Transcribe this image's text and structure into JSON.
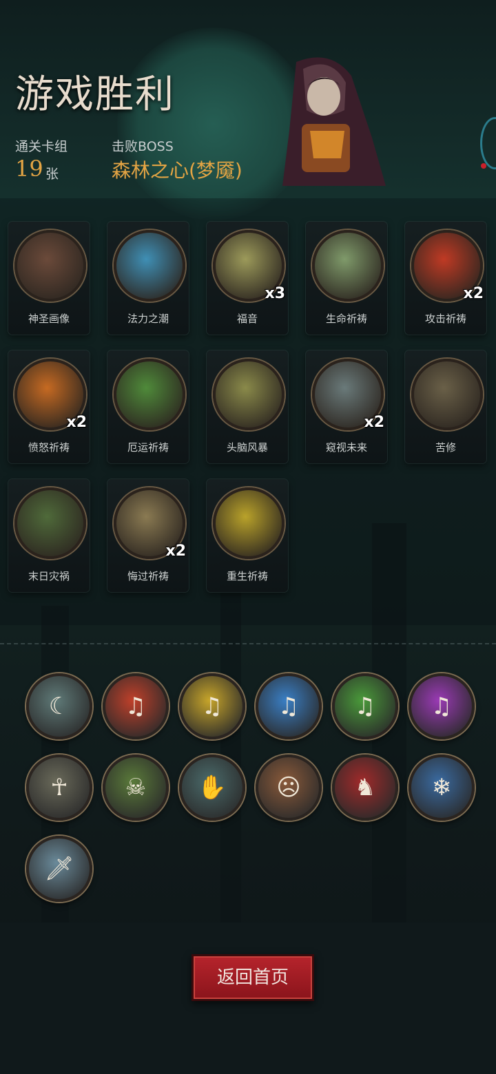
{
  "header": {
    "title": "游戏胜利",
    "deck_label": "通关卡组",
    "deck_count": "19",
    "deck_unit": "张",
    "boss_label": "击败BOSS",
    "boss_name": "森林之心(梦魇)"
  },
  "cards": [
    {
      "name": "神圣画像",
      "count": "",
      "icon": "holy-portrait-icon",
      "color": "#6b4a3a"
    },
    {
      "name": "法力之潮",
      "count": "",
      "icon": "mana-tide-icon",
      "color": "#3f8fb5"
    },
    {
      "name": "福音",
      "count": "x3",
      "icon": "gospel-hammer-icon",
      "color": "#9c9a5a"
    },
    {
      "name": "生命祈祷",
      "count": "",
      "icon": "life-prayer-icon",
      "color": "#7f9a6a"
    },
    {
      "name": "攻击祈祷",
      "count": "x2",
      "icon": "attack-prayer-icon",
      "color": "#c03a24"
    },
    {
      "name": "愤怒祈祷",
      "count": "x2",
      "icon": "wrath-prayer-icon",
      "color": "#c66a22"
    },
    {
      "name": "厄运祈祷",
      "count": "",
      "icon": "doom-prayer-icon",
      "color": "#4f8a3a"
    },
    {
      "name": "头脑风暴",
      "count": "",
      "icon": "brainstorm-icon",
      "color": "#8a8a4a"
    },
    {
      "name": "窥视未来",
      "count": "x2",
      "icon": "foresight-icon",
      "color": "#6a7a7a"
    },
    {
      "name": "苦修",
      "count": "",
      "icon": "penance-icon",
      "color": "#6a6048"
    },
    {
      "name": "末日灾祸",
      "count": "",
      "icon": "doomsday-icon",
      "color": "#4f6a3a"
    },
    {
      "name": "悔过祈祷",
      "count": "x2",
      "icon": "repentance-icon",
      "color": "#8a7a52"
    },
    {
      "name": "重生祈祷",
      "count": "",
      "icon": "rebirth-prayer-icon",
      "color": "#b9a22a"
    }
  ],
  "relics": [
    {
      "icon": "crescent-moon-icon",
      "glyph": "☾",
      "color": "#5f7a78"
    },
    {
      "icon": "red-music-skull-icon",
      "glyph": "♫",
      "color": "#c0402a"
    },
    {
      "icon": "yellow-music-skull-icon",
      "glyph": "♫",
      "color": "#c7a52a"
    },
    {
      "icon": "blue-music-skull-icon",
      "glyph": "♫",
      "color": "#3a7fc5"
    },
    {
      "icon": "green-music-skull-icon",
      "glyph": "♫",
      "color": "#4a9a3a"
    },
    {
      "icon": "purple-music-skull-icon",
      "glyph": "♫",
      "color": "#9a3ab5"
    },
    {
      "icon": "prophet-icon",
      "glyph": "☥",
      "color": "#6a6a5a"
    },
    {
      "icon": "ghost-ogre-icon",
      "glyph": "☠",
      "color": "#5a7a3a"
    },
    {
      "icon": "card-hand-icon",
      "glyph": "✋",
      "color": "#4a6a6a"
    },
    {
      "icon": "pirate-face-icon",
      "glyph": "☹",
      "color": "#8a5a3a"
    },
    {
      "icon": "red-demon-icon",
      "glyph": "♞",
      "color": "#a02a2a"
    },
    {
      "icon": "frost-mirror-icon",
      "glyph": "❄",
      "color": "#3a6aa0"
    },
    {
      "icon": "dagger-icon",
      "glyph": "🗡",
      "color": "#6a8a9a"
    }
  ],
  "return_button": "返回首页"
}
